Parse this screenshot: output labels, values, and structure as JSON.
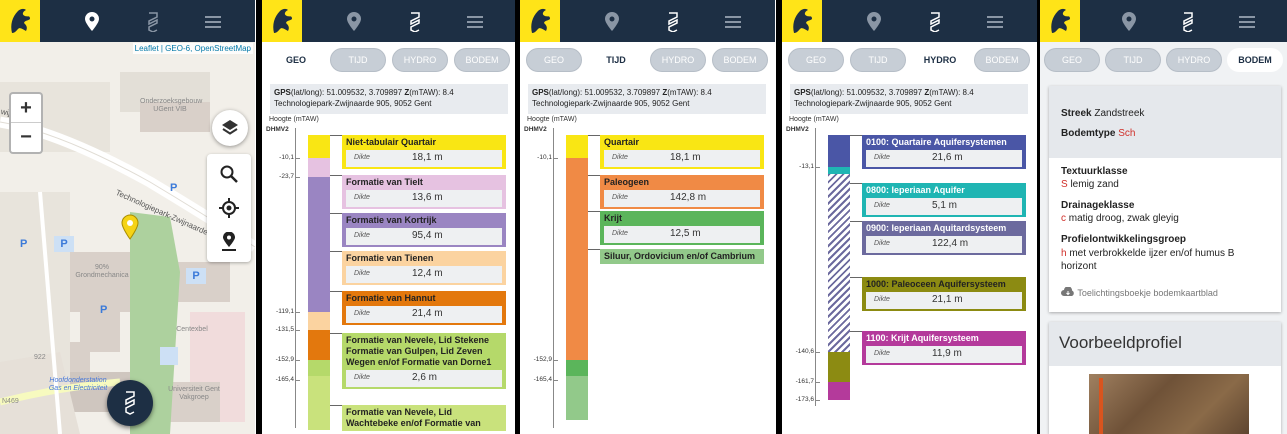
{
  "map_panel": {
    "attribution": "Leaflet | GEO-6, OpenStreetMap",
    "zoom_in": "+",
    "zoom_out": "−",
    "labels": {
      "onderzoek": "Onderzoeksgebouw UGent VIB",
      "grondmechanica": "90% Grondmechanica",
      "centexbel": "Centexbel",
      "universiteit": "Universiteit Gent Vakgroep",
      "hoofdonderstation": "Hoofdonderstation Gas en Electriciteit",
      "n469": "N469",
      "num922": "922",
      "road_a": "Technologiepark-Zwijnaarde",
      "road_b": "wijnaarde"
    },
    "parking": "P"
  },
  "common": {
    "gps_label": "GPS",
    "gps_text": "(lat/long): 51.009532, 3.709897",
    "z_label": "Z",
    "z_text": "(mTAW): 8.4",
    "address": "Technologiepark-Zwijnaarde 905, 9052 Gent",
    "hoogte": "Hoogte (mTAW)",
    "dhmv": "DHMV2",
    "dikte_label": "Dikte",
    "tabs": [
      "GEO",
      "TIJD",
      "HYDRO",
      "BODEM"
    ]
  },
  "geo": {
    "ticks": [
      "-10,1",
      "-23,7",
      "-119,1",
      "-131,5",
      "-152,9",
      "-165,4"
    ],
    "layers": [
      {
        "name": "Niet-tabulair Quartair",
        "dikte": "18,1 m",
        "color": "#f9e614"
      },
      {
        "name": "Formatie van Tielt",
        "dikte": "13,6 m",
        "color": "#e6c2e1"
      },
      {
        "name": "Formatie van Kortrijk",
        "dikte": "95,4 m",
        "color": "#9a85c2"
      },
      {
        "name": "Formatie van Tienen",
        "dikte": "12,4 m",
        "color": "#fbd3a0"
      },
      {
        "name": "Formatie van Hannut",
        "dikte": "21,4 m",
        "color": "#e3780d"
      },
      {
        "name": "Formatie van Nevele, Lid Stekene Formatie van Gulpen, Lid Zeven Wegen en/of Formatie van Dorne1",
        "dikte": "2,6 m",
        "color": "#b5d96a"
      },
      {
        "name": "Formatie van Nevele, Lid Wachtebeke en/of Formatie van",
        "dikte": "",
        "color": "#c9e27c"
      }
    ]
  },
  "tijd": {
    "ticks": [
      "-10,1",
      "-152,9",
      "-165,4"
    ],
    "layers": [
      {
        "name": "Quartair",
        "dikte": "18,1 m",
        "color": "#f9e614"
      },
      {
        "name": "Paleogeen",
        "dikte": "142,8 m",
        "color": "#f08a45"
      },
      {
        "name": "Krijt",
        "dikte": "12,5 m",
        "color": "#5bb55b"
      },
      {
        "name": "Siluur, Ordovicium en/of Cambrium",
        "dikte": "",
        "color": "#92c98a"
      }
    ]
  },
  "hydro": {
    "ticks": [
      "-13,1",
      "-140,6",
      "-161,7",
      "-173,6"
    ],
    "layers": [
      {
        "name": "0100: Quartaire Aquifersystemen",
        "dikte": "21,6 m",
        "color": "#4a56a6"
      },
      {
        "name": "0800: Ieperiaan Aquifer",
        "dikte": "5,1 m",
        "color": "#1fb5b3"
      },
      {
        "name": "0900: Ieperiaan Aquitardsysteem",
        "dikte": "122,4 m",
        "color": "#6c6a9e"
      },
      {
        "name": "1000: Paleoceen Aquifersysteem",
        "dikte": "21,1 m",
        "color": "#8c8b12"
      },
      {
        "name": "1100: Krijt Aquifersysteem",
        "dikte": "11,9 m",
        "color": "#b43a9b"
      }
    ]
  },
  "bodem": {
    "streek_label": "Streek",
    "streek_value": "Zandstreek",
    "bodemtype_label": "Bodemtype",
    "bodemtype_value": "Sch",
    "textuur_label": "Textuurklasse",
    "textuur_code": "S",
    "textuur_value": "lemig zand",
    "drainage_label": "Drainageklasse",
    "drainage_code": "c",
    "drainage_value": "matig droog, zwak gleyig",
    "profiel_label": "Profielontwikkelingsgroep",
    "profiel_code": "h",
    "profiel_value": "met verbrokkelde ijzer en/of humus B horizont",
    "link": "Toelichtingsboekje bodemkaartblad",
    "voorbeeld": "Voorbeeldprofiel"
  }
}
